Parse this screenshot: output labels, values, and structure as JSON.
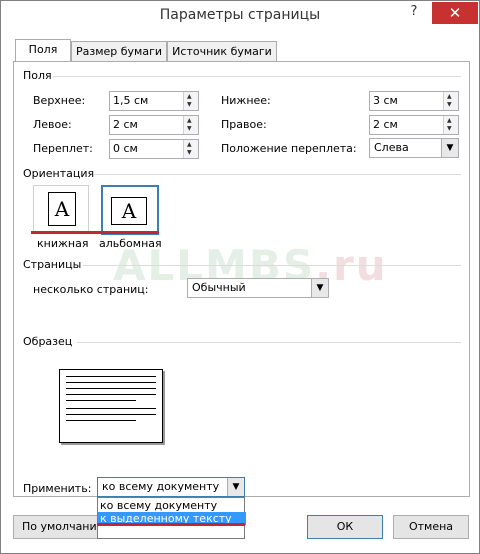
{
  "window": {
    "title": "Параметры страницы",
    "help": "?",
    "close": "✕"
  },
  "tabs": [
    {
      "label": "Поля",
      "active": true
    },
    {
      "label": "Размер бумаги",
      "active": false
    },
    {
      "label": "Источник бумаги",
      "active": false
    }
  ],
  "margins": {
    "heading": "Поля",
    "top_label": "Верхнее:",
    "top_value": "1,5 см",
    "bottom_label": "Нижнее:",
    "bottom_value": "3 см",
    "left_label": "Левое:",
    "left_value": "2 см",
    "right_label": "Правое:",
    "right_value": "2 см",
    "gutter_label": "Переплет:",
    "gutter_value": "0 см",
    "gutter_pos_label": "Положение переплета:",
    "gutter_pos_value": "Слева"
  },
  "orientation": {
    "heading": "Ориентация",
    "portrait_glyph": "A",
    "portrait_label": "книжная",
    "landscape_glyph": "A",
    "landscape_label": "альбомная"
  },
  "pages": {
    "heading": "Страницы",
    "multiple_label": "несколько страниц:",
    "multiple_value": "Обычный"
  },
  "preview": {
    "heading": "Образец"
  },
  "apply": {
    "label": "Применить:",
    "value": "ко всему документу",
    "options": [
      "ко всему документу",
      "к выделенному тексту"
    ],
    "selected_index": 1
  },
  "watermark": {
    "main": "ALLMBS",
    "ru": ".ru"
  },
  "buttons": {
    "default": "По умолчанию",
    "ok": "ОК",
    "cancel": "Отмена"
  },
  "colors": {
    "close_bg": "#c7312f",
    "highlight": "#3399ff",
    "annotation": "#c0283a"
  }
}
